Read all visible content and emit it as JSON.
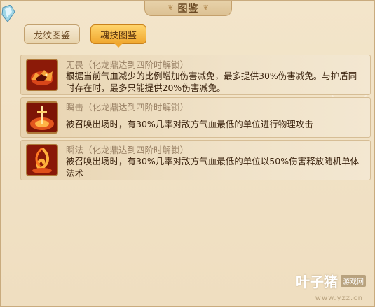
{
  "window": {
    "title": "图鉴"
  },
  "tabs": [
    {
      "label": "龙纹图鉴",
      "active": false
    },
    {
      "label": "魂技图鉴",
      "active": true
    }
  ],
  "skills": [
    {
      "name": "无畏（化龙鼎达到四阶时解锁）",
      "description": "根据当前气血减少的比例增加伤害减免，最多提供30%伤害减免。与护盾同时存在时，最多只能提供20%伤害减免。",
      "icon": "beast-fire-icon"
    },
    {
      "name": "瞬击（化龙鼎达到四阶时解锁）",
      "description": "被召唤出场时，有30%几率对敌方气血最低的单位进行物理攻击",
      "icon": "sword-fire-icon"
    },
    {
      "name": "瞬法（化龙鼎达到四阶时解锁）",
      "description": "被召唤出场时，有30%几率对敌方气血最低的单位以50%伤害释放随机单体法术",
      "icon": "flame-swirl-icon"
    }
  ],
  "watermark": {
    "text": "叶子猪",
    "badge": "游戏网",
    "url": "www.yzz.cn"
  },
  "colors": {
    "accent": "#f0a72e",
    "panel": "#efdfc3",
    "text": "#3d2510",
    "muted": "#9a8266"
  }
}
